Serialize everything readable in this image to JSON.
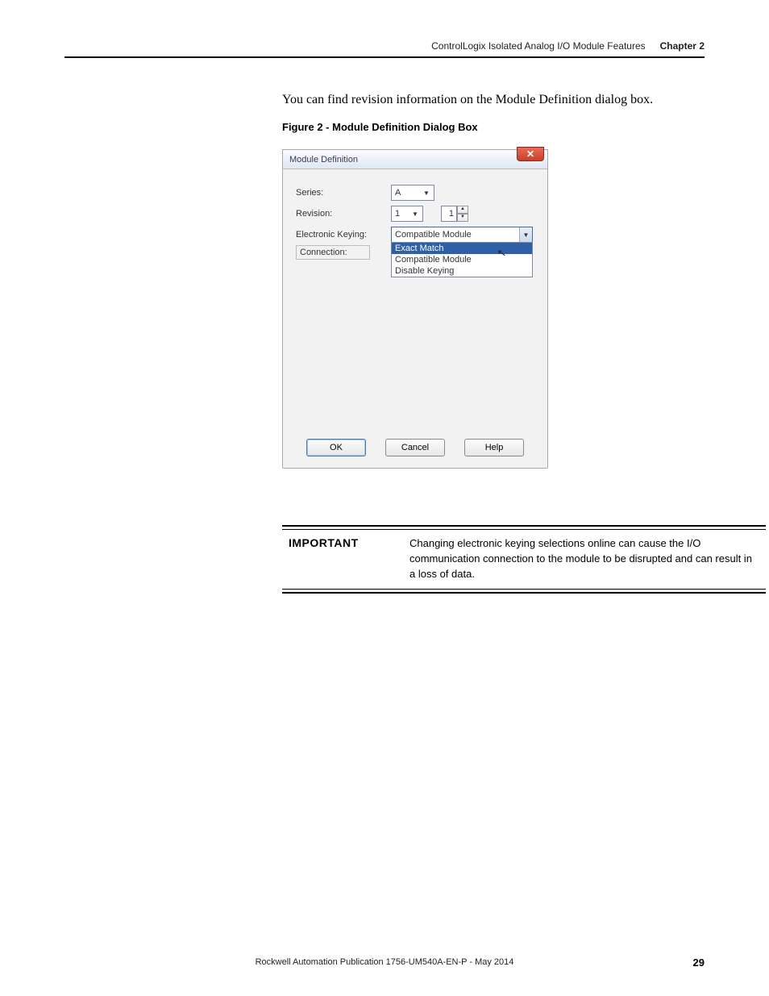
{
  "header": {
    "section": "ControlLogix Isolated Analog I/O Module Features",
    "chapter": "Chapter 2"
  },
  "intro": "You can find revision information on the Module Definition dialog box.",
  "figure_caption": "Figure 2 - Module Definition Dialog Box",
  "dialog": {
    "title": "Module Definition",
    "close_glyph": "✕",
    "labels": {
      "series": "Series:",
      "revision": "Revision:",
      "keying": "Electronic Keying:",
      "connection": "Connection:"
    },
    "values": {
      "series": "A",
      "revision_major": "1",
      "revision_minor": "1",
      "keying_selected": "Compatible Module"
    },
    "keying_options": [
      "Exact Match",
      "Compatible Module",
      "Disable Keying"
    ],
    "buttons": {
      "ok": "OK",
      "cancel": "Cancel",
      "help": "Help"
    }
  },
  "callout": {
    "label": "IMPORTANT",
    "text": "Changing electronic keying selections online can cause the I/O communication connection to the module to be disrupted and can result in a loss of data."
  },
  "footer": {
    "pub": "Rockwell Automation Publication 1756-UM540A-EN-P - May 2014",
    "page": "29"
  }
}
